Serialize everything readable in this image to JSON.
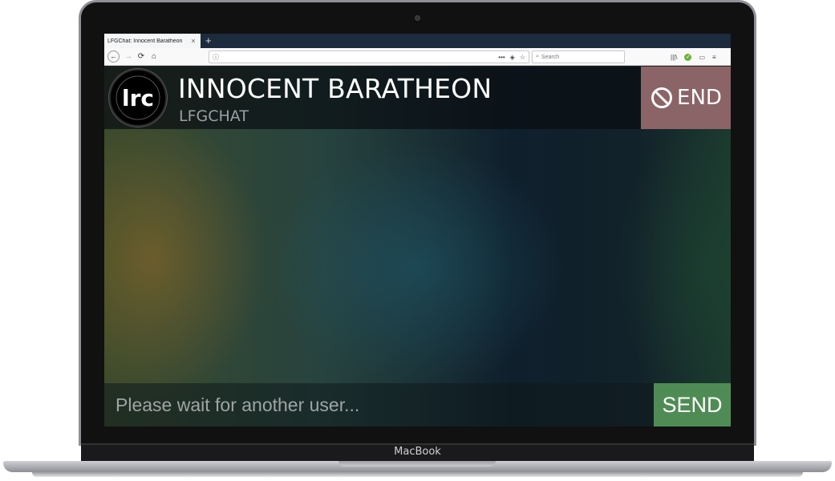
{
  "browser": {
    "tab_title": "LFGChat: Innocent Baratheon",
    "tab_close": "×",
    "new_tab": "+",
    "back": "←",
    "forward": "→",
    "reload": "⟳",
    "home": "⌂",
    "url_info": "ⓘ",
    "url_more": "•••",
    "pocket": "◈",
    "bookmark": "☆",
    "search_icon": "⌕",
    "search_placeholder": "Search",
    "library": "|||\\",
    "sync_ok": "✓",
    "sidebar": "▭",
    "menu": "≡"
  },
  "app": {
    "logo_text": "lrc",
    "user_name": "INNOCENT BARATHEON",
    "app_name": "LFGCHAT",
    "end_label": "END",
    "message_placeholder": "Please wait for another user...",
    "send_label": "SEND"
  },
  "device": {
    "brand": "MacBook"
  },
  "colors": {
    "end_button": "#8a6466",
    "send_button": "#4f8c55",
    "header": "#0a0e12"
  }
}
